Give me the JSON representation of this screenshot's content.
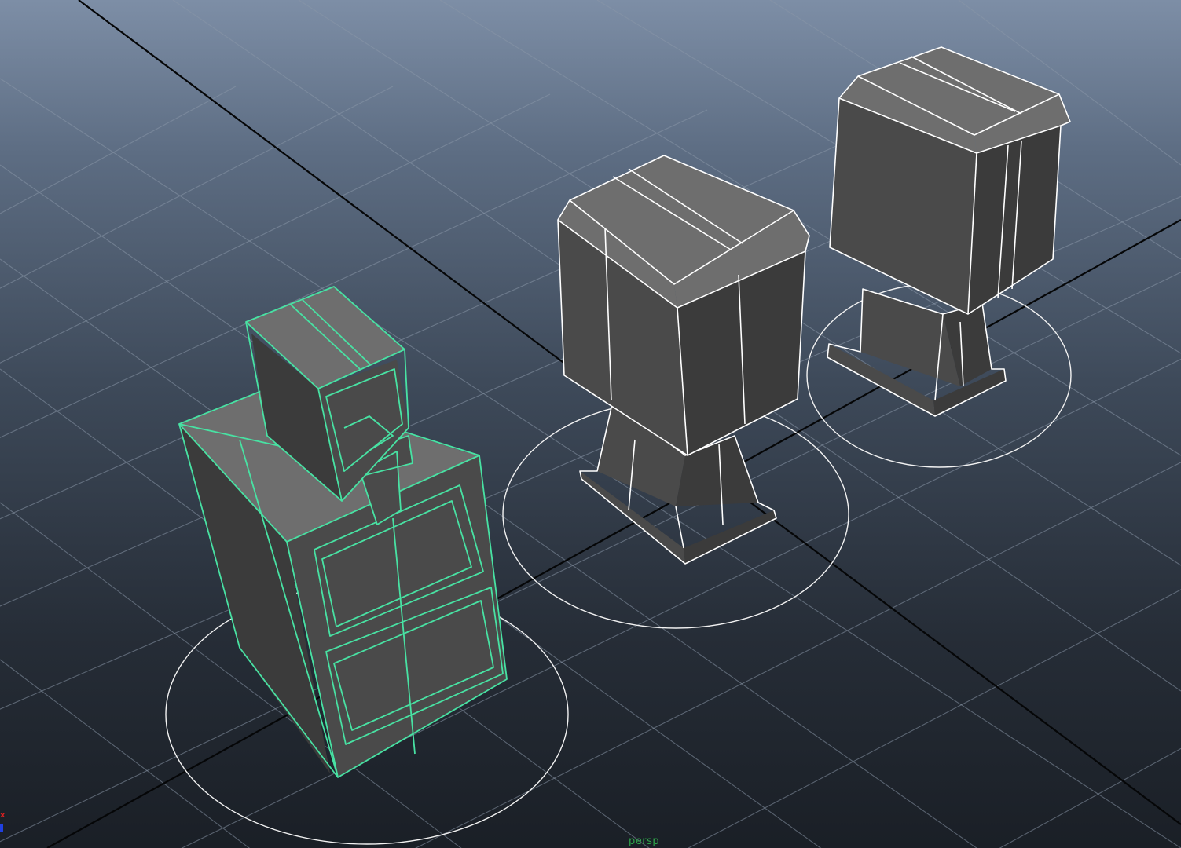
{
  "viewport": {
    "camera_label": "persp",
    "background_top": "#7d8ea6",
    "background_bottom": "#1a1f26",
    "selection_color": "#48e2a3",
    "wireframe_color": "#ffffff",
    "axis_gizmo": {
      "x_label": "x",
      "x_color": "#e02020",
      "z_color": "#2040e0"
    }
  },
  "objects": [
    {
      "name": "hatted-character",
      "state": "selected"
    },
    {
      "name": "box-character-center",
      "state": "unselected"
    },
    {
      "name": "box-character-back",
      "state": "unselected"
    }
  ]
}
